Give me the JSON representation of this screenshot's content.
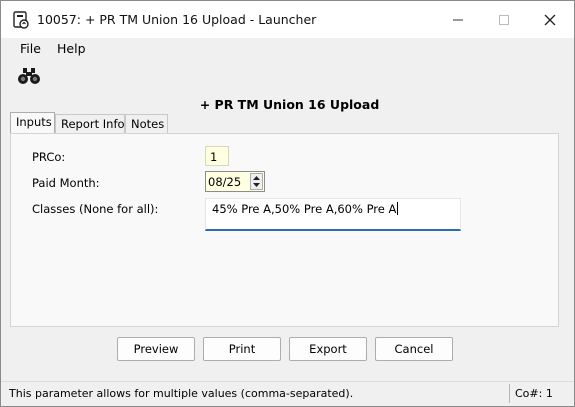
{
  "window": {
    "title": "10057: + PR TM Union 16 Upload - Launcher",
    "app_icon": "report-launcher-icon",
    "controls": {
      "minimize": "—",
      "maximize": "□",
      "close": "✕"
    }
  },
  "menu": {
    "file": "File",
    "help": "Help"
  },
  "toolbar": {
    "lookup_icon": "binoculars-icon"
  },
  "report": {
    "title": "+ PR TM Union 16 Upload"
  },
  "tabs": [
    {
      "label": "Inputs",
      "active": true
    },
    {
      "label": "Report Info",
      "active": false
    },
    {
      "label": "Notes",
      "active": false
    }
  ],
  "params": {
    "prco": {
      "label": "PRCo:",
      "value": "1"
    },
    "paid_month": {
      "label": "Paid Month:",
      "value": "08/25"
    },
    "classes": {
      "label": "Classes (None for all):",
      "value": "45% Pre A,50% Pre A,60% Pre A"
    }
  },
  "buttons": {
    "preview": "Preview",
    "print": "Print",
    "export": "Export",
    "cancel": "Cancel"
  },
  "status": {
    "message": "This parameter allows for multiple values (comma-separated).",
    "company": "Co#: 1"
  },
  "colors": {
    "input_required_bg": "#ffffe1",
    "focus_underline": "#2b6ab0",
    "window_bg": "#f0f0f0"
  }
}
